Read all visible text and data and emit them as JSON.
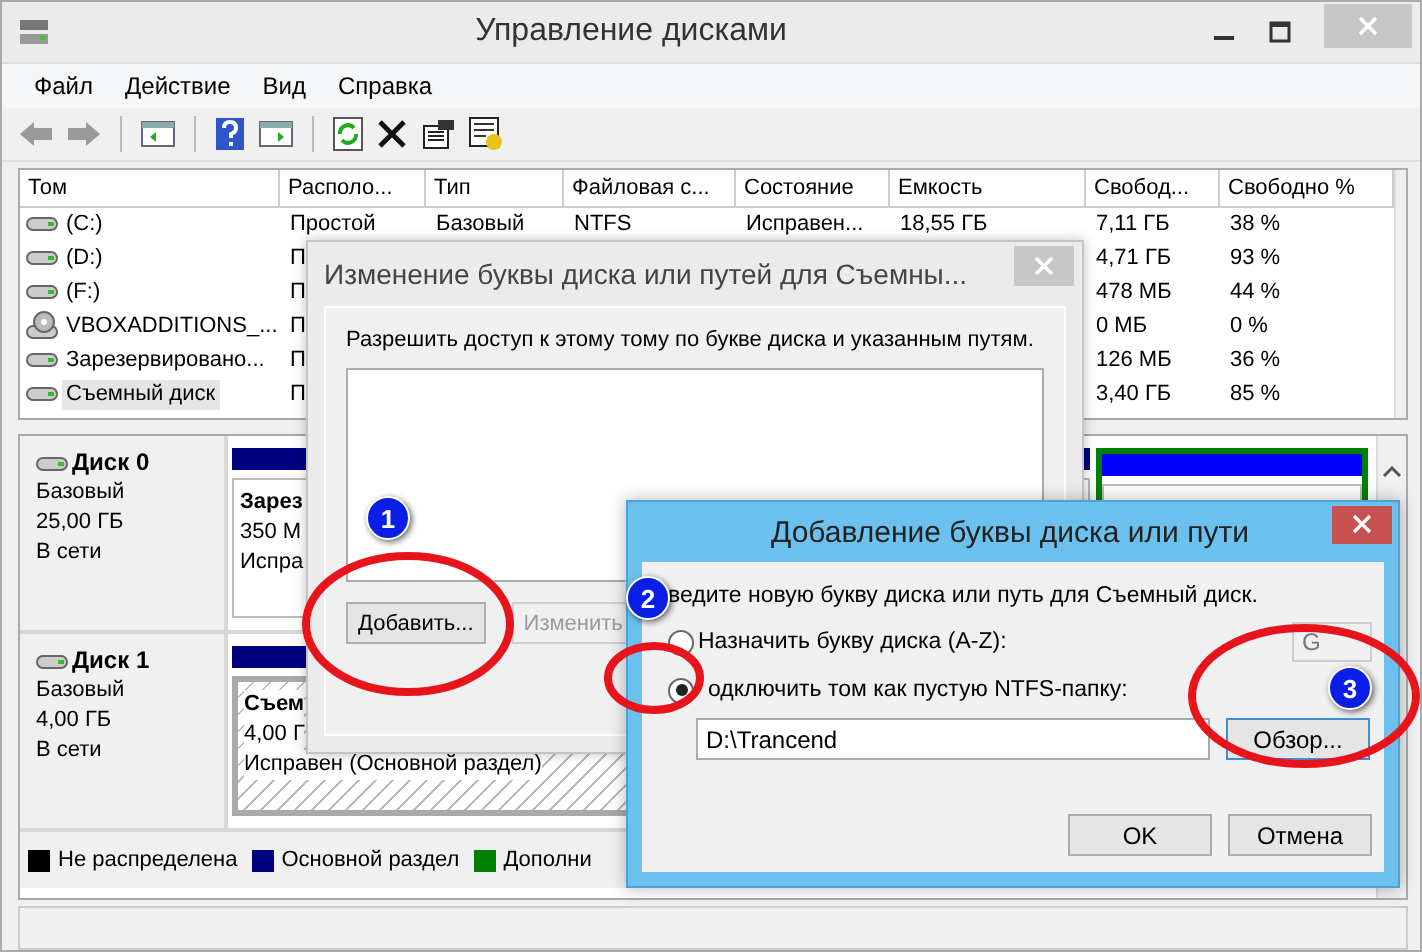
{
  "window": {
    "title": "Управление дисками"
  },
  "menu": [
    {
      "label": "Файл"
    },
    {
      "label": "Действие"
    },
    {
      "label": "Вид"
    },
    {
      "label": "Справка"
    }
  ],
  "toolbar": [
    {
      "kind": "back",
      "disabled": true
    },
    {
      "kind": "forward",
      "disabled": true
    },
    {
      "kind": "sep"
    },
    {
      "kind": "panel"
    },
    {
      "kind": "sep"
    },
    {
      "kind": "help"
    },
    {
      "kind": "panel2"
    },
    {
      "kind": "sep"
    },
    {
      "kind": "refresh"
    },
    {
      "kind": "delete"
    },
    {
      "kind": "properties"
    },
    {
      "kind": "wizard"
    }
  ],
  "table": {
    "columns": [
      "Том",
      "Располо...",
      "Тип",
      "Файловая с...",
      "Состояние",
      "Емкость",
      "Свобод...",
      "Свободно %"
    ],
    "rows": [
      {
        "kind": "drive",
        "selected": false,
        "cells": {
          "volume": "(C:)",
          "layout": "Простой",
          "type": "Базовый",
          "fs": "NTFS",
          "status": "Исправен...",
          "capacity": "18,55 ГБ",
          "free": "7,11 ГБ",
          "pct": "38 %"
        }
      },
      {
        "kind": "drive",
        "selected": false,
        "cells": {
          "volume": "(D:)",
          "layout": "П",
          "free": "4,71 ГБ",
          "pct": "93 %"
        }
      },
      {
        "kind": "drive",
        "selected": false,
        "cells": {
          "volume": "(F:)",
          "layout": "П",
          "free": "478 МБ",
          "pct": "44 %"
        }
      },
      {
        "kind": "cd",
        "selected": false,
        "cells": {
          "volume": "VBOXADDITIONS_...",
          "layout": "П",
          "free": "0 МБ",
          "pct": "0 %"
        }
      },
      {
        "kind": "drive",
        "selected": false,
        "cells": {
          "volume": "Зарезервировано...",
          "layout": "П",
          "free": "126 МБ",
          "pct": "36 %"
        }
      },
      {
        "kind": "drive",
        "selected": true,
        "cells": {
          "volume": "Съемный диск",
          "layout": "П",
          "free": "3,40 ГБ",
          "pct": "85 %"
        }
      }
    ]
  },
  "disks": [
    {
      "name": "Диск 0",
      "type": "Базовый",
      "size": "25,00 ГБ",
      "status": "В сети",
      "partitions": [
        {
          "kind": "primary",
          "selected": false,
          "lines": [
            "Зарез",
            "350 М",
            "Испра"
          ]
        },
        {
          "kind": "logical",
          "selected": false
        }
      ]
    },
    {
      "name": "Диск 1",
      "type": "Базовый",
      "size": "4,00 ГБ",
      "status": "В сети",
      "partitions": [
        {
          "kind": "primary",
          "selected": true,
          "lines": [
            "Съем",
            "4,00 Г",
            "Исправен (Основной раздел)"
          ]
        }
      ]
    }
  ],
  "legend": [
    {
      "label": "Не распределена",
      "color": "#000000"
    },
    {
      "label": "Основной раздел",
      "color": "#000080"
    },
    {
      "label": "Дополни",
      "color": "#008000"
    }
  ],
  "dialog_paths": {
    "title": "Изменение буквы диска или путей для Съемны...",
    "prompt": "Разрешить доступ к этому тому по букве диска и указанным путям.",
    "buttons": [
      {
        "label": "Добавить...",
        "disabled": false
      },
      {
        "label": "Изменить",
        "disabled": true
      }
    ]
  },
  "dialog_add": {
    "title": "Добавление буквы диска или пути",
    "prompt": "ведите новую букву диска или путь для Съемный диск.",
    "options": [
      {
        "label": "Назначить букву диска (A-Z):",
        "selected": false
      },
      {
        "label": "одключить том как пустую NTFS-папку:",
        "selected": true
      }
    ],
    "letter": {
      "value": "G",
      "disabled": true
    },
    "path": {
      "value": "D:\\Trancend"
    },
    "browse": "Обзор...",
    "ok": "OK",
    "cancel": "Отмена"
  },
  "annotations": [
    {
      "label": "1"
    },
    {
      "label": "2"
    },
    {
      "label": "3"
    }
  ]
}
